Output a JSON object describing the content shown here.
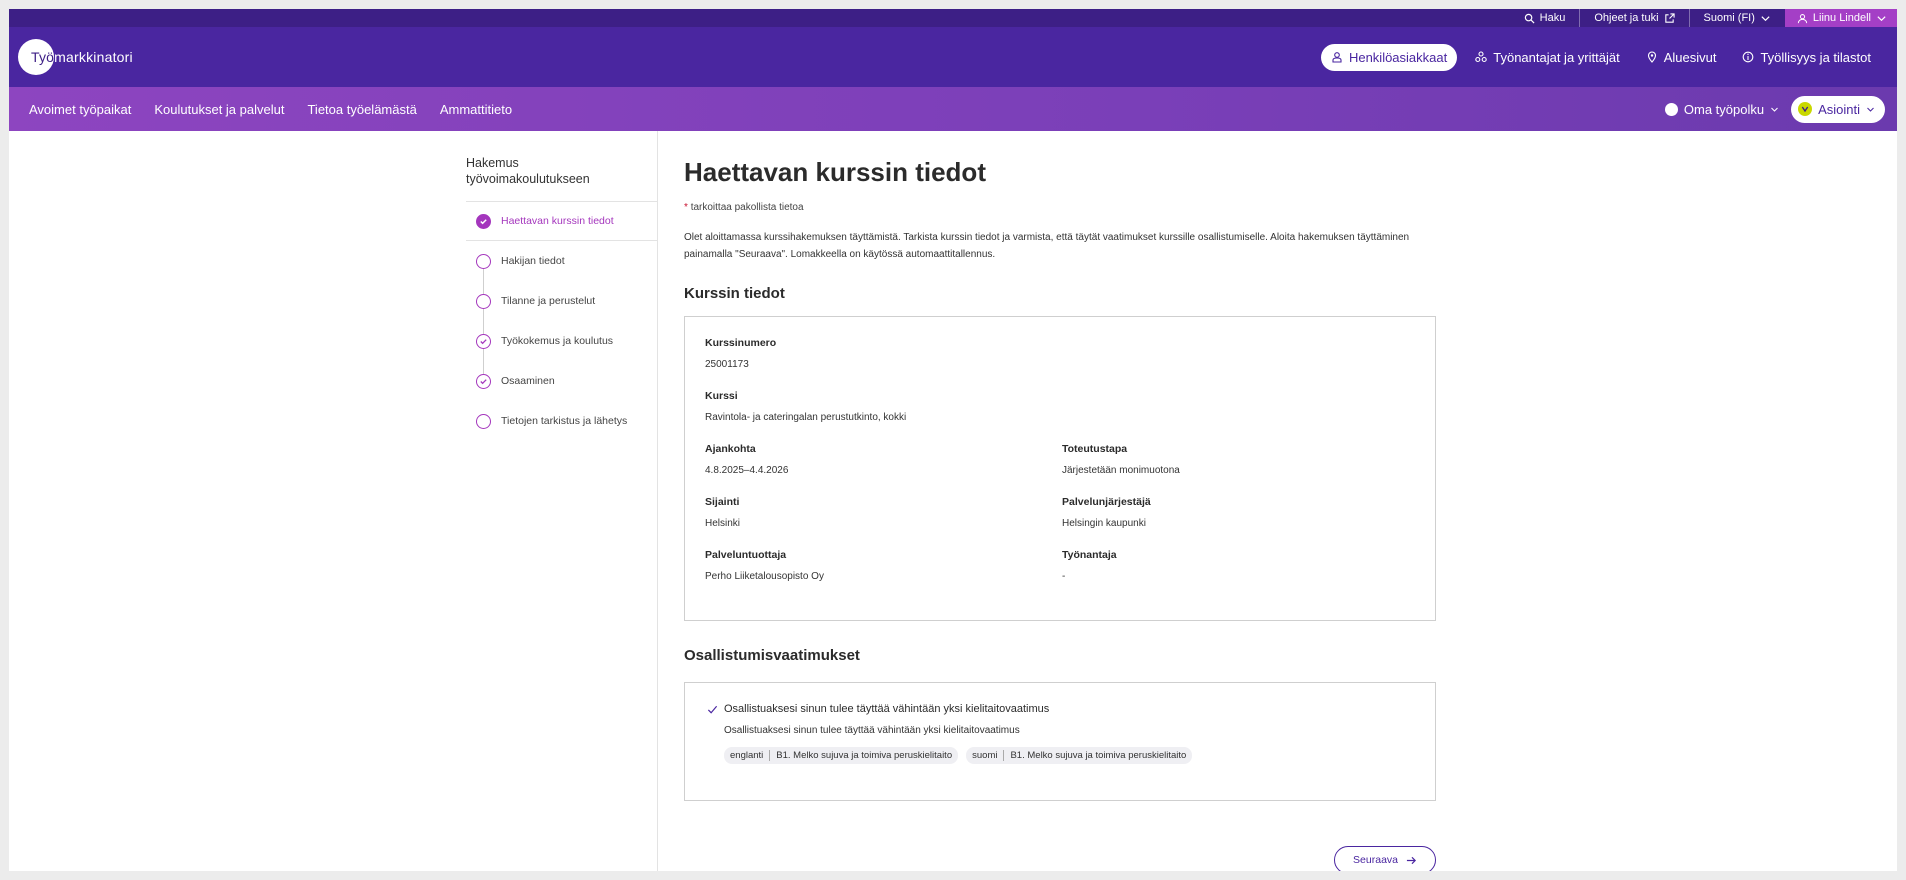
{
  "utility": {
    "search": "Haku",
    "help": "Ohjeet ja tuki",
    "language": "Suomi (FI)",
    "user": "Liinu Lindell"
  },
  "header": {
    "logo": {
      "text_part1": "Työ",
      "text_part2": "markkinatori"
    },
    "nav": [
      {
        "label": "Henkilöasiakkaat",
        "icon": "person-icon",
        "active": true
      },
      {
        "label": "Työnantajat ja yrittäjät",
        "icon": "group-icon"
      },
      {
        "label": "Aluesivut",
        "icon": "location-pin-icon"
      },
      {
        "label": "Työllisyys ja tilastot",
        "icon": "info-icon"
      }
    ]
  },
  "mainnav": {
    "items": [
      "Avoimet työpaikat",
      "Koulutukset ja palvelut",
      "Tietoa työelämästä",
      "Ammattitieto"
    ],
    "omapolku": "Oma työpolku",
    "asiointi": "Asiointi"
  },
  "sidebar": {
    "title": "Hakemus työvoimakoulutukseen",
    "steps": [
      {
        "label": "Haettavan kurssin tiedot",
        "state": "active"
      },
      {
        "label": "Hakijan tiedot",
        "state": "empty"
      },
      {
        "label": "Tilanne ja perustelut",
        "state": "empty"
      },
      {
        "label": "Työkokemus ja koulutus",
        "state": "checked"
      },
      {
        "label": "Osaaminen",
        "state": "checked"
      },
      {
        "label": "Tietojen tarkistus ja lähetys",
        "state": "empty"
      }
    ]
  },
  "main": {
    "title": "Haettavan kurssin tiedot",
    "required_star": "*",
    "required_note": "tarkoittaa pakollista tietoa",
    "intro": "Olet aloittamassa kurssihakemuksen täyttämistä. Tarkista kurssin tiedot ja varmista, että täytät vaatimukset kurssille osallistumiselle. Aloita hakemuksen täyttäminen painamalla \"Seuraava\". Lomakkeella on käytössä automaattitallennus.",
    "course_section_title": "Kurssin tiedot",
    "course": {
      "number_label": "Kurssinumero",
      "number": "25001173",
      "course_label": "Kurssi",
      "course": "Ravintola- ja catering­alan perustutkinto, kokki",
      "time_label": "Ajankohta",
      "time": "4.8.2025–4.4.2026",
      "method_label": "Toteutustapa",
      "method": "Järjestetään monimuotona",
      "location_label": "Sijainti",
      "location": "Helsinki",
      "organizer_label": "Palvelunjärjestäjä",
      "organizer": "Helsingin kaupunki",
      "producer_label": "Palveluntuottaja",
      "producer": "Perho Liiketalousopisto Oy",
      "employer_label": "Työnantaja",
      "employer": "-"
    },
    "requirements_title": "Osallistumisvaatimukset",
    "requirement": {
      "heading": "Osallistuaksesi sinun tulee täyttää vähintään yksi kielitaitovaatimus",
      "sub": "Osallistuaksesi sinun tulee täyttää vähintään yksi kielitaitovaatimus",
      "chips": [
        {
          "language": "englanti",
          "level": "B1. Melko sujuva ja toimiva peruskielitaito"
        },
        {
          "language": "suomi",
          "level": "B1. Melko sujuva ja toimiva peruskielitaito"
        }
      ]
    },
    "next_button": "Seuraava"
  },
  "colors": {
    "header": "#4a26a0",
    "utility": "#3d1f86",
    "accent": "#a436bd",
    "user_tab": "#a43fc6"
  }
}
